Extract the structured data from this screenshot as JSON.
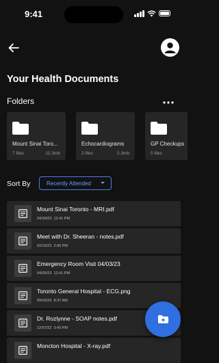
{
  "status_bar": {
    "time": "9:41"
  },
  "header": {
    "title": "Your Health Documents"
  },
  "folders": {
    "label": "Folders",
    "more_icon": "more-horizontal-icon",
    "items": [
      {
        "name": "Mount Sinai Toro...",
        "count": "7 files",
        "size": "12.3mb"
      },
      {
        "name": "Echocardiograms",
        "count": "2 files",
        "size": "2.3mb"
      },
      {
        "name": "GP Checkups",
        "count": "5 files",
        "size": ""
      }
    ]
  },
  "sort": {
    "label": "Sort By",
    "selected": "Recently Attended"
  },
  "documents": [
    {
      "name": "Mount Sinai Toronto - MRI.pdf",
      "date": "04/30/23",
      "time": "12:41 PM"
    },
    {
      "name": "Meet with Dr. Sheeran - notes.pdf",
      "date": "02/15/23",
      "time": "2:06 PM"
    },
    {
      "name": "Emergency Room Visit 04/03/23",
      "date": "04/30/23",
      "time": "12:41 PM"
    },
    {
      "name": "Toronto General Hospital - ECG.png",
      "date": "09/03/23",
      "time": "8:37 AM"
    },
    {
      "name": "Dr. Rozlynne - SOAP notes.pdf",
      "date": "12/07/22",
      "time": "3:43 PM"
    },
    {
      "name": "Moncton Hospital - X-ray.pdf",
      "date": "",
      "time": ""
    }
  ],
  "colors": {
    "background": "#121212",
    "card": "#262626",
    "accent": "#2f6fe0",
    "accent_text": "#6f9bff"
  }
}
